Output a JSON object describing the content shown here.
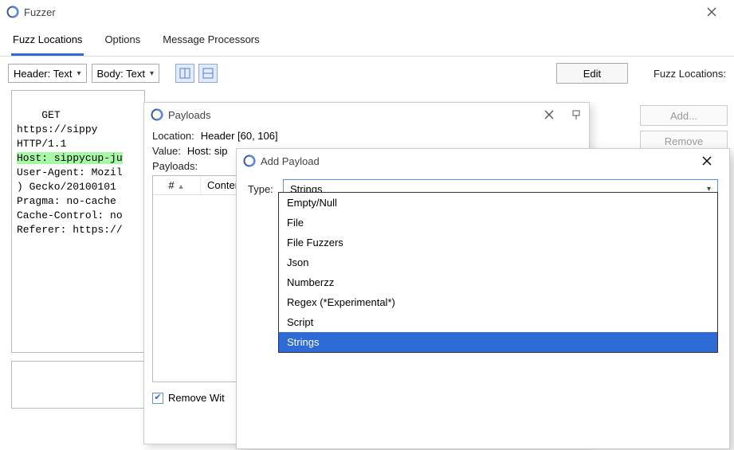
{
  "main_window": {
    "title": "Fuzzer",
    "tabs": [
      "Fuzz Locations",
      "Options",
      "Message Processors"
    ],
    "active_tab_index": 0,
    "toolbar": {
      "header_select": "Header: Text",
      "body_select": "Body: Text",
      "edit_btn": "Edit",
      "fuzz_loc_label": "Fuzz Locations:"
    },
    "side_buttons": {
      "add": "Add...",
      "remove": "Remove"
    },
    "request_lines_pre": "GET https://sippy\nHTTP/1.1\n",
    "request_highlight": "Host: sippycup-ju",
    "request_lines_post": "\nUser-Agent: Mozil\n) Gecko/20100101\nPragma: no-cache\nCache-Control: no\nReferer: https://"
  },
  "payloads_window": {
    "title": "Payloads",
    "location_label": "Location:",
    "location_value": "Header [60, 106]",
    "value_label": "Value:",
    "value_value": "Host: sip",
    "payloads_label": "Payloads:",
    "table_headers": {
      "num": "#",
      "content": "Conten"
    },
    "remove_whitespace_label": "Remove Wit",
    "remove_whitespace_checked": true
  },
  "add_payload_window": {
    "title": "Add Payload",
    "type_label": "Type:",
    "selected_type": "Strings",
    "options": [
      "Empty/Null",
      "File",
      "File Fuzzers",
      "Json",
      "Numberzz",
      "Regex (*Experimental*)",
      "Script",
      "Strings"
    ],
    "selected_index": 7
  }
}
